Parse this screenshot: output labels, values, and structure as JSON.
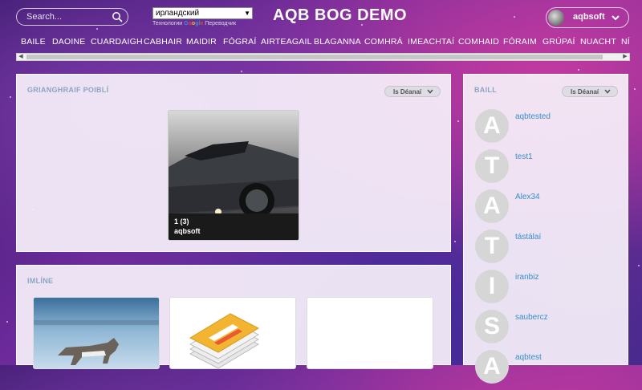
{
  "header": {
    "search_placeholder": "Search...",
    "language": "ирландский",
    "translate_prefix": "Технологии",
    "translate_brand": "Google",
    "translate_suffix": "Переводчик",
    "site_title": "AQB BOG DEMO",
    "username": "aqbsoft"
  },
  "nav": {
    "items": [
      "BAILE",
      "DAOINE",
      "CUARDAIGH",
      "CABHAIR",
      "MAIDIR",
      "FÓGRAÍ",
      "AIRTEAGAIL",
      "BLAGANNA",
      "COMHRÁ",
      "IMEACHTAÍ",
      "COMHAID",
      "FÓRAIM",
      "GRÚPAÍ",
      "NUACHT",
      "NÍ"
    ]
  },
  "photos_panel": {
    "title": "GRIANGHRAIF POIBLÍ",
    "sort_label": "Is Déanaí",
    "card": {
      "count": "1 (3)",
      "owner": "aqbsoft"
    }
  },
  "bookmarks_panel": {
    "title": "IMLÍNE"
  },
  "members_panel": {
    "title": "BAILL",
    "sort_label": "Is Déanaí",
    "members": [
      {
        "initial": "A",
        "name": "aqbtested"
      },
      {
        "initial": "T",
        "name": "test1"
      },
      {
        "initial": "A",
        "name": "Alex34"
      },
      {
        "initial": "T",
        "name": "tástálaí"
      },
      {
        "initial": "I",
        "name": "iranbiz"
      },
      {
        "initial": "S",
        "name": "saubercz"
      },
      {
        "initial": "A",
        "name": "aqbtest"
      }
    ]
  },
  "colors": {
    "accent_link": "#3a8ec9",
    "panel_title": "#8ba6c2"
  }
}
